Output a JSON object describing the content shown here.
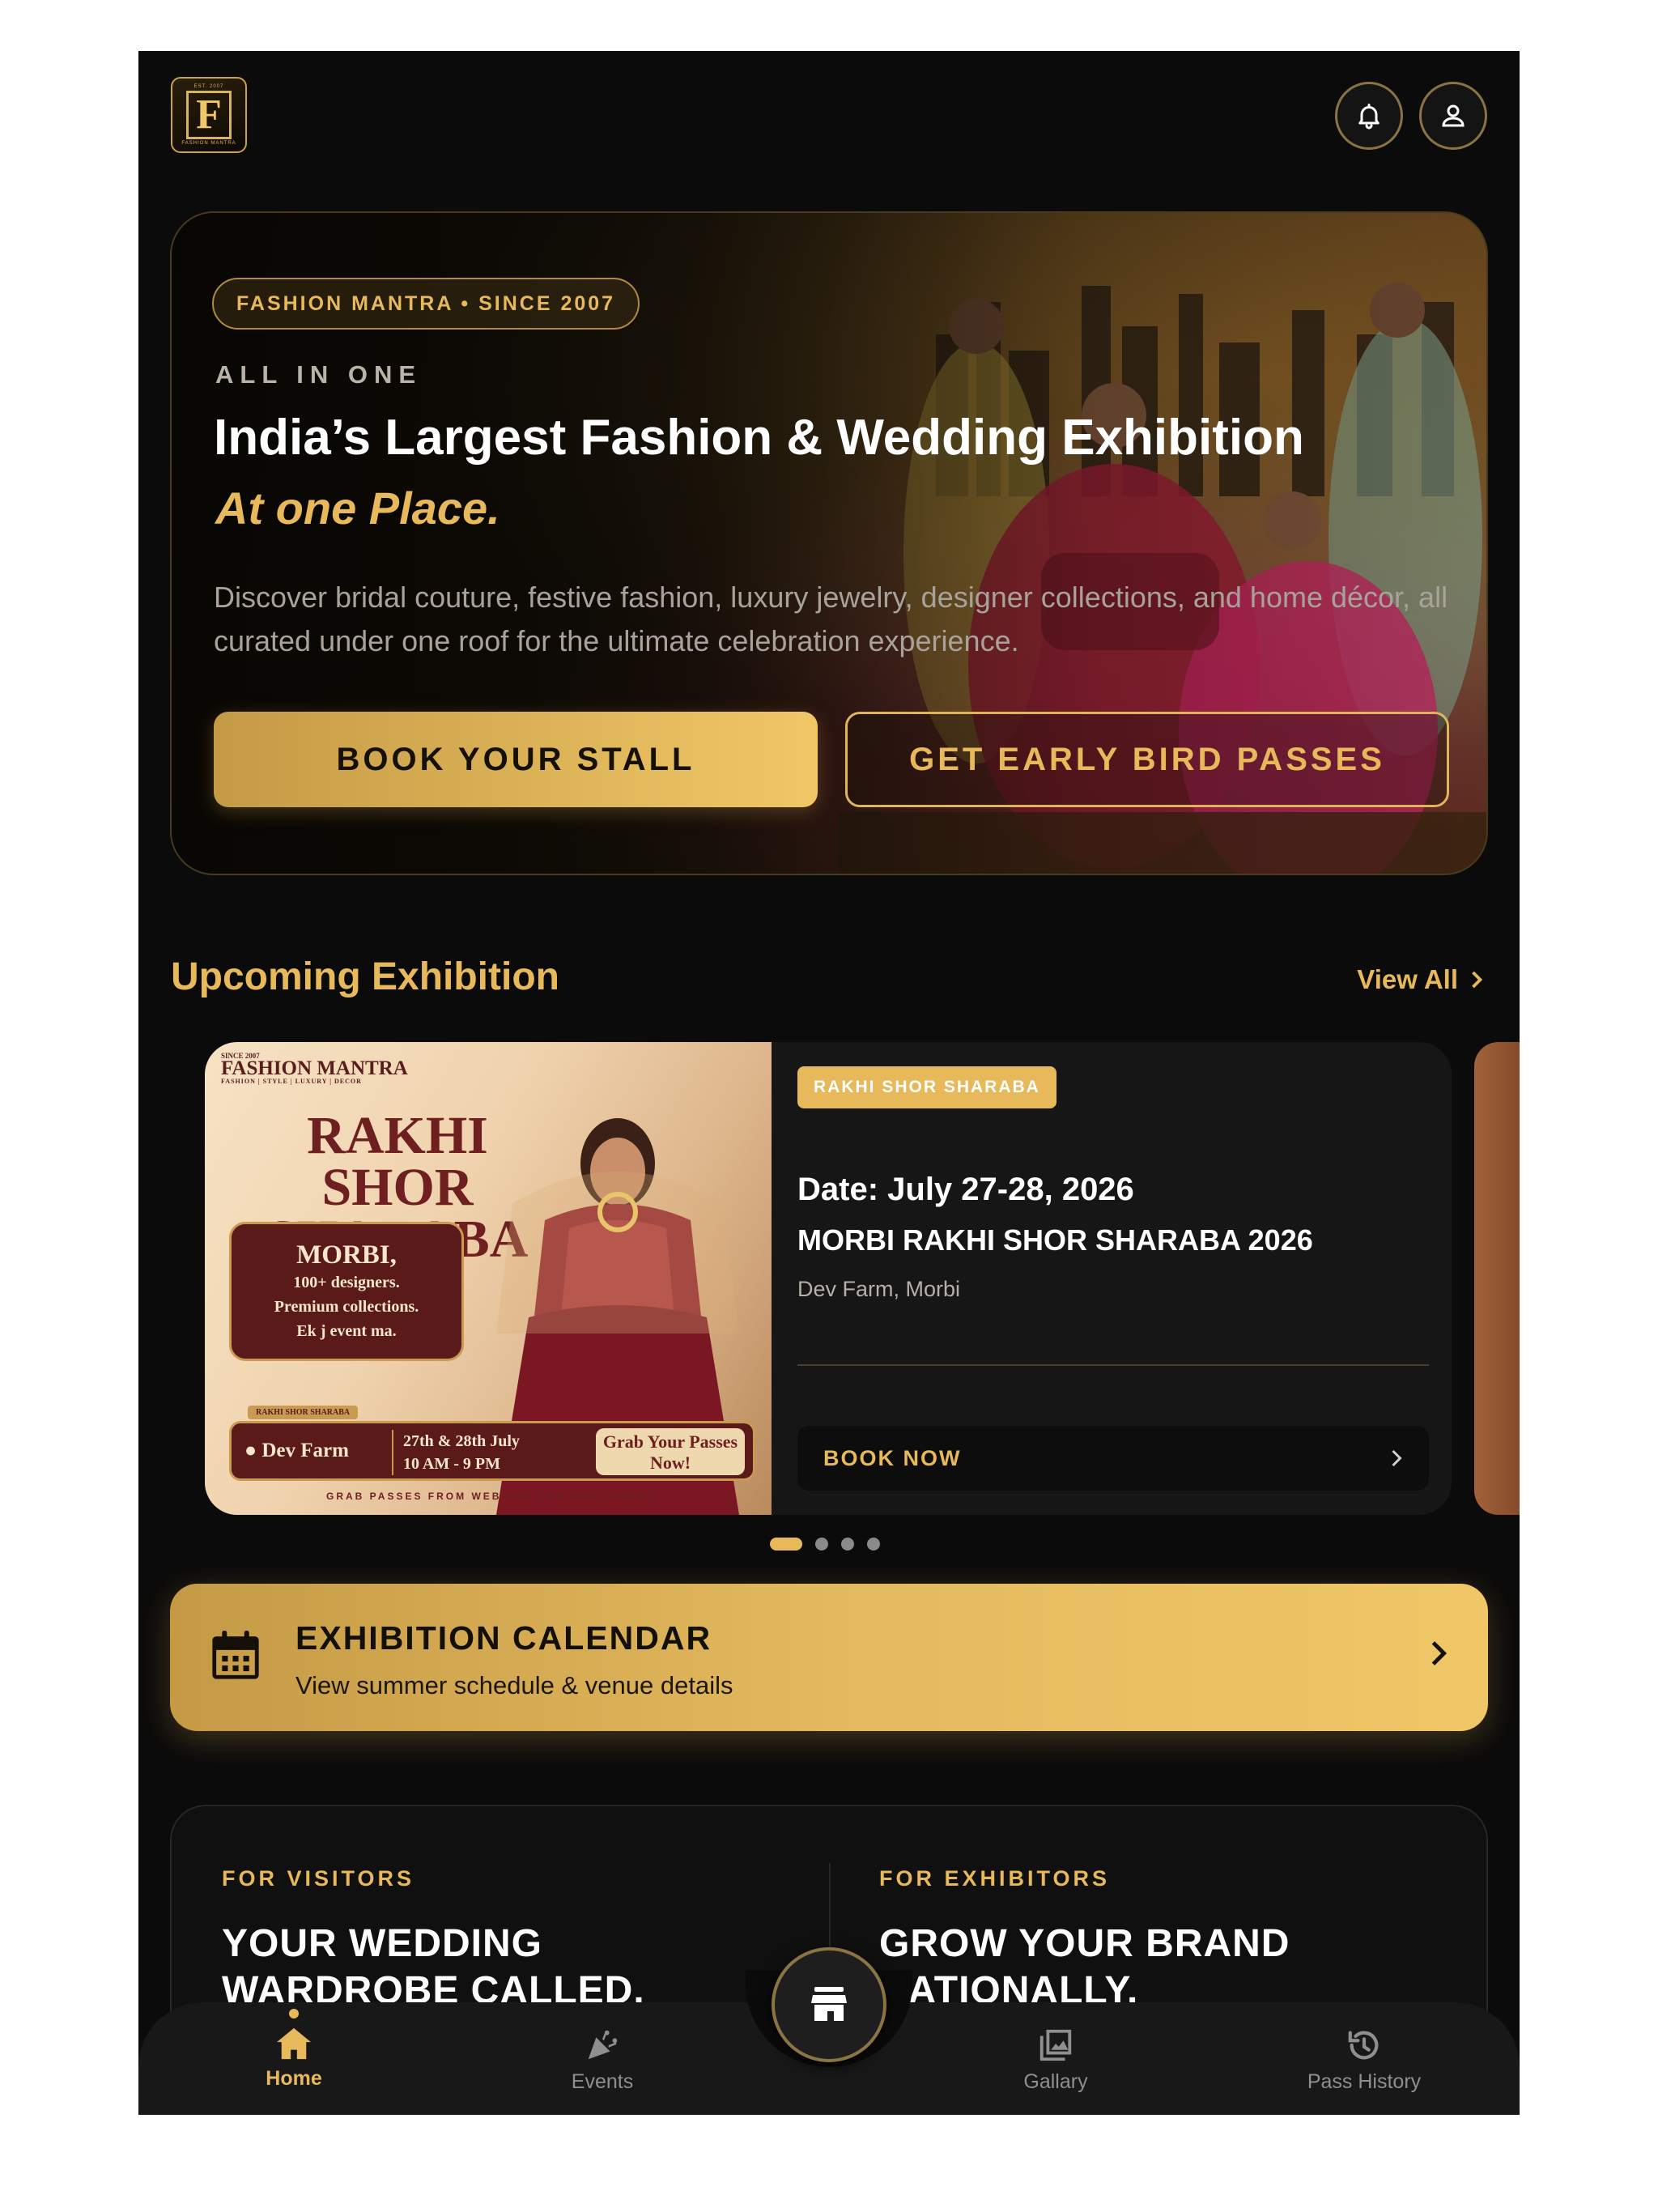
{
  "logo": {
    "tiny_top": "EST. 2007",
    "letter": "F",
    "tiny_bottom": "FASHION MANTRA"
  },
  "header": {
    "notification_icon": "bell-icon",
    "profile_icon": "user-icon"
  },
  "hero": {
    "badge": "FASHION MANTRA • SINCE 2007",
    "eyebrow": "ALL IN ONE",
    "title": "India’s Largest Fashion & Wedding Exhibition",
    "accent": "At one Place.",
    "description": "Discover bridal couture, festive fashion, luxury jewelry, designer collections, and home décor, all curated under one roof for the ultimate celebration experience.",
    "primary_cta": "BOOK YOUR STALL",
    "secondary_cta": "GET EARLY BIRD PASSES"
  },
  "upcoming": {
    "title": "Upcoming Exhibition",
    "view_all": "View All",
    "card": {
      "poster": {
        "since": "SINCE 2007",
        "brand": "FASHION MANTRA",
        "tagline": "FASHION | STYLE | LUXURY | DECOR",
        "title_line1": "RAKHI",
        "title_line2": "SHOR SHARABA",
        "city": "MORBI,",
        "line1": "100+ designers.",
        "line2": "Premium collections.",
        "line3": "Ek j event ma.",
        "bar_tab": "RAKHI SHOR SHARABA",
        "location": "Dev Farm",
        "dates": "27th & 28th July",
        "time": "10 AM - 9 PM",
        "grab": "Grab Your Passes Now!",
        "footer": "GRAB PASSES FROM WEBSITE FOR FREE ENTRY"
      },
      "tag": "RAKHI SHOR SHARABA",
      "date": "Date: July 27-28, 2026",
      "name": "MORBI RAKHI SHOR SHARABA 2026",
      "venue": "Dev Farm, Morbi",
      "cta": "BOOK NOW"
    },
    "carousel_pages": 4,
    "carousel_active": 1
  },
  "calendar": {
    "icon": "calendar-icon",
    "title": "EXHIBITION CALENDAR",
    "subtitle": "View summer schedule & venue details"
  },
  "roles": {
    "visitors": {
      "eyebrow": "FOR VISITORS",
      "headline_line1": "YOUR WEDDING",
      "headline_line2": "WARDROBE CALLED."
    },
    "exhibitors": {
      "eyebrow": "FOR EXHIBITORS",
      "headline_line1": "GROW YOUR BRAND",
      "headline_line2": "NATIONALLY."
    }
  },
  "nav": {
    "items": [
      {
        "label": "Home",
        "icon": "home-icon",
        "active": true
      },
      {
        "label": "Events",
        "icon": "party-popper-icon",
        "active": false
      },
      {
        "label": "Gallary",
        "icon": "gallery-icon",
        "active": false
      },
      {
        "label": "Pass History",
        "icon": "history-icon",
        "active": false
      }
    ],
    "center_icon": "store-icon"
  },
  "colors": {
    "accent": "#e8b95a",
    "background": "#0b0b0b",
    "gold_start": "#c59a45",
    "gold_end": "#f0c767"
  }
}
